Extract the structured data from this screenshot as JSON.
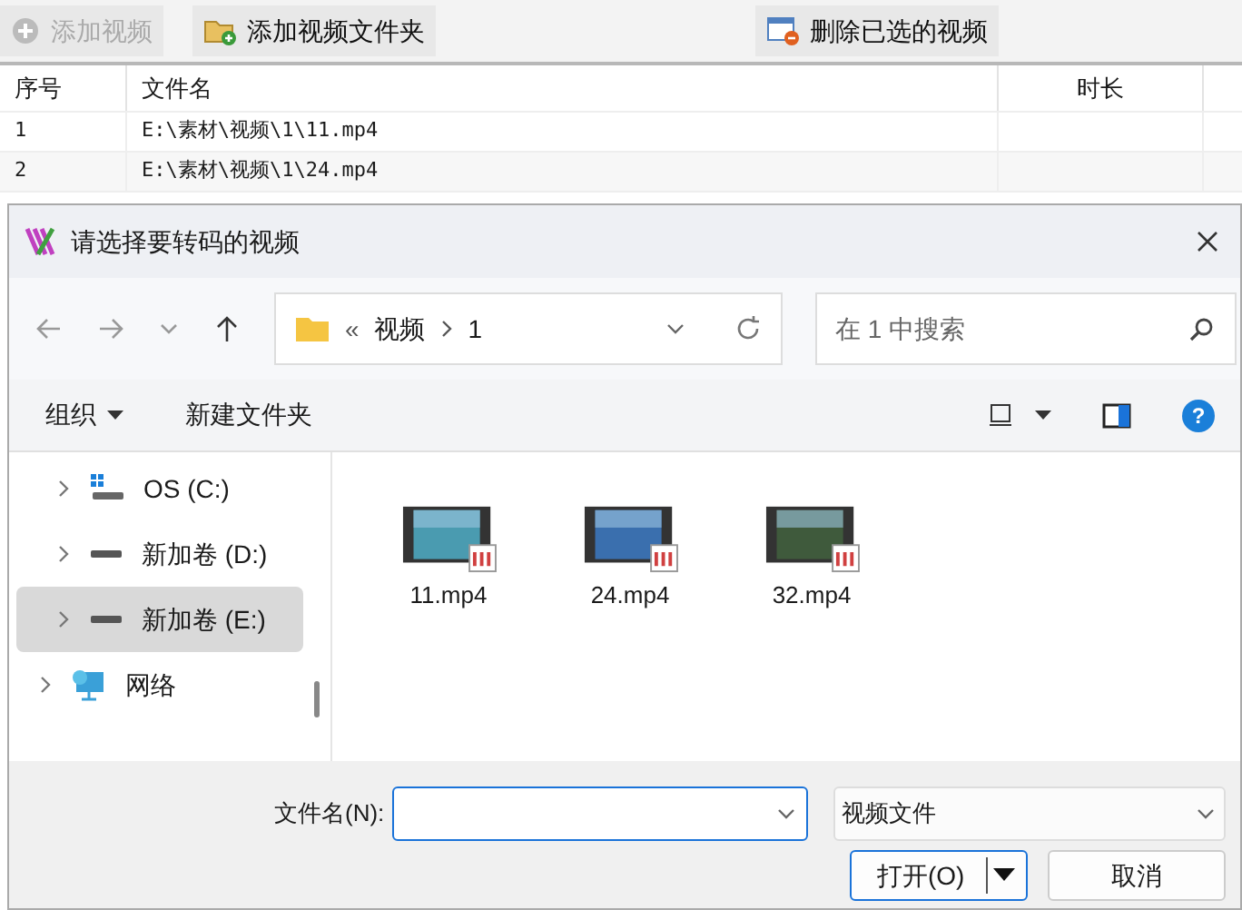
{
  "toolbar": [
    {
      "label": "添加视频",
      "disabled": true,
      "kind": "add"
    },
    {
      "label": "添加视频文件夹",
      "disabled": false,
      "kind": "folder"
    },
    {
      "label": "删除已选的视频",
      "disabled": false,
      "kind": "remove"
    }
  ],
  "table": {
    "columns": [
      "序号",
      "文件名",
      "时长"
    ],
    "rows": [
      {
        "cells": [
          "1",
          "E:\\素材\\视频\\1\\11.mp4",
          ""
        ]
      },
      {
        "cells": [
          "2",
          "E:\\素材\\视频\\1\\24.mp4",
          ""
        ]
      }
    ]
  },
  "dialog": {
    "title": "请选择要转码的视频",
    "breadcrumb": {
      "overflow": "«",
      "parts": [
        "视频",
        "1"
      ]
    },
    "search": {
      "placeholder": "在 1 中搜索"
    },
    "commands": [
      {
        "label": "组织",
        "dropdown": true
      },
      {
        "label": "新建文件夹",
        "dropdown": false
      }
    ],
    "sidebar": [
      {
        "label": "OS (C:)",
        "kind": "os-drive",
        "selected": false
      },
      {
        "label": "新加卷 (D:)",
        "kind": "drive",
        "selected": false
      },
      {
        "label": "新加卷 (E:)",
        "kind": "drive",
        "selected": true
      },
      {
        "label": "网络",
        "kind": "network",
        "selected": false
      }
    ],
    "files": [
      {
        "name": "11.mp4",
        "color": "#4a9bb0"
      },
      {
        "name": "24.mp4",
        "color": "#3a6fae"
      },
      {
        "name": "32.mp4",
        "color": "#3f5a3c"
      }
    ],
    "help": "?",
    "filename": {
      "label": "文件名(N):"
    },
    "filetype": {
      "value": "视频文件"
    },
    "buttons": [
      {
        "label": "打开(O)",
        "primary": true
      },
      {
        "label": "取消",
        "primary": false
      }
    ]
  }
}
